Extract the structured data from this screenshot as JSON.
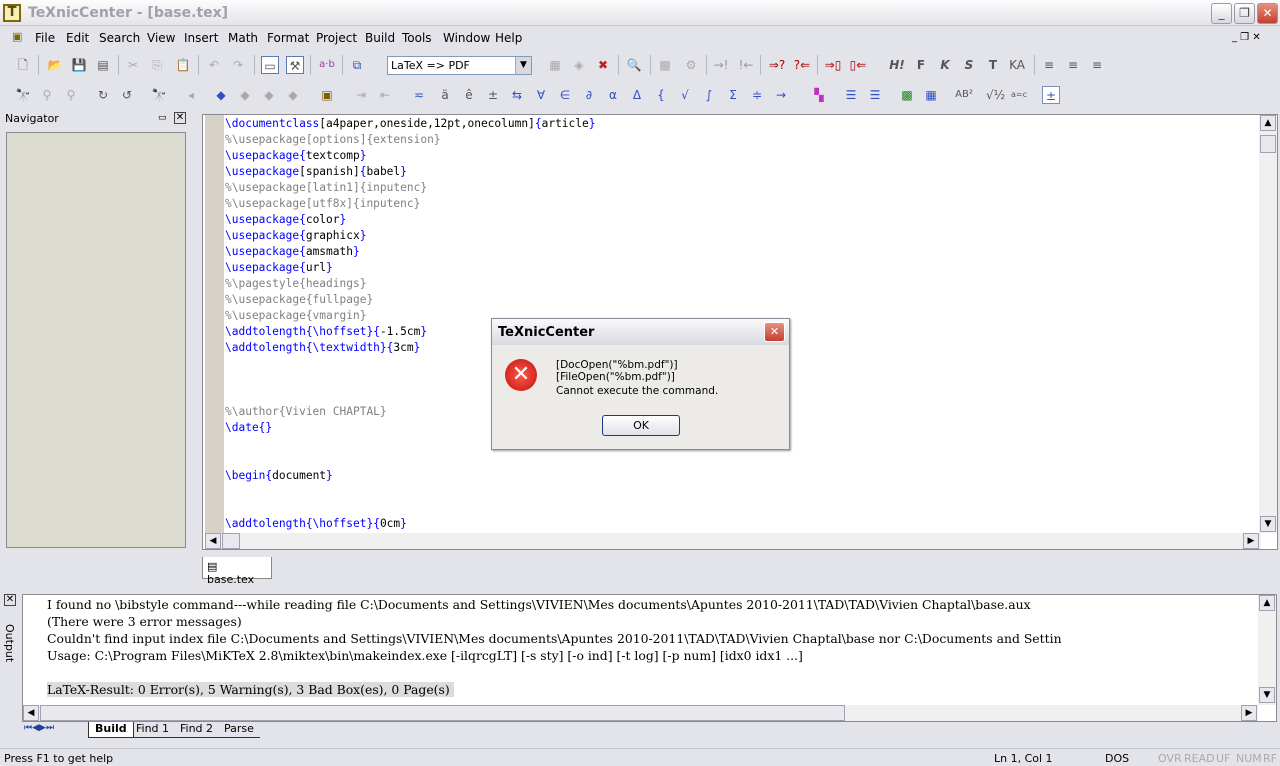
{
  "window": {
    "title": "TeXnicCenter - [base.tex]",
    "app_icon": "T"
  },
  "menu": [
    "File",
    "Edit",
    "Search",
    "View",
    "Insert",
    "Math",
    "Format",
    "Project",
    "Build",
    "Tools",
    "Window",
    "Help"
  ],
  "toolbar": {
    "build_profile": "LaTeX => PDF",
    "format_buttons": [
      "H!",
      "F",
      "K",
      "S",
      "T",
      "KA"
    ],
    "spell_label": "a·b"
  },
  "navigator": {
    "title": "Navigator"
  },
  "editor": {
    "lines": [
      [
        [
          "kw",
          "\\documentclass"
        ],
        [
          "",
          "[a4paper,oneside,12pt,onecolumn]"
        ],
        [
          "kw",
          "{"
        ],
        [
          "",
          "article"
        ],
        [
          "kw",
          "}"
        ]
      ],
      [
        [
          "cm",
          "%\\usepackage[options]{extension}"
        ]
      ],
      [
        [
          "kw",
          "\\usepackage{"
        ],
        [
          "",
          "textcomp"
        ],
        [
          "kw",
          "}"
        ]
      ],
      [
        [
          "kw",
          "\\usepackage"
        ],
        [
          "",
          "[spanish]"
        ],
        [
          "kw",
          "{"
        ],
        [
          "",
          "babel"
        ],
        [
          "kw",
          "}"
        ]
      ],
      [
        [
          "cm",
          "%\\usepackage[latin1]{inputenc}"
        ]
      ],
      [
        [
          "cm",
          "%\\usepackage[utf8x]{inputenc}"
        ]
      ],
      [
        [
          "kw",
          "\\usepackage{"
        ],
        [
          "",
          "color"
        ],
        [
          "kw",
          "}"
        ]
      ],
      [
        [
          "kw",
          "\\usepackage{"
        ],
        [
          "",
          "graphicx"
        ],
        [
          "kw",
          "}"
        ]
      ],
      [
        [
          "kw",
          "\\usepackage{"
        ],
        [
          "",
          "amsmath"
        ],
        [
          "kw",
          "}"
        ]
      ],
      [
        [
          "kw",
          "\\usepackage{"
        ],
        [
          "",
          "url"
        ],
        [
          "kw",
          "}"
        ]
      ],
      [
        [
          "cm",
          "%\\pagestyle{headings}"
        ]
      ],
      [
        [
          "cm",
          "%\\usepackage{fullpage}"
        ]
      ],
      [
        [
          "cm",
          "%\\usepackage{vmargin}"
        ]
      ],
      [
        [
          "kw",
          "\\addtolength{\\hoffset}"
        ],
        [
          "kw",
          "{"
        ],
        [
          "",
          "-1.5cm"
        ],
        [
          "kw",
          "}"
        ]
      ],
      [
        [
          "kw",
          "\\addtolength{\\textwidth}"
        ],
        [
          "kw",
          "{"
        ],
        [
          "",
          "3cm"
        ],
        [
          "kw",
          "}"
        ]
      ],
      [],
      [],
      [],
      [
        [
          "cm",
          "%\\author{Vivien CHAPTAL}"
        ]
      ],
      [
        [
          "kw",
          "\\date{}"
        ]
      ],
      [],
      [],
      [
        [
          "kw",
          "\\begin{"
        ],
        [
          "",
          "document"
        ],
        [
          "kw",
          "}"
        ]
      ],
      [],
      [],
      [
        [
          "kw",
          "\\addtolength{\\hoffset}"
        ],
        [
          "kw",
          "{"
        ],
        [
          "",
          "0cm"
        ],
        [
          "kw",
          "}"
        ]
      ]
    ],
    "tab": "base.tex"
  },
  "output": {
    "label": "Output",
    "lines": [
      "I found no \\bibstyle command---while reading file C:\\Documents and Settings\\VIVIEN\\Mes documents\\Apuntes 2010-2011\\TAD\\TAD\\Vivien Chaptal\\base.aux",
      "(There were 3 error messages)",
      "Couldn't find input index file C:\\Documents and Settings\\VIVIEN\\Mes documents\\Apuntes 2010-2011\\TAD\\TAD\\Vivien Chaptal\\base nor C:\\Documents and Settin",
      "Usage: C:\\Program Files\\MiKTeX 2.8\\miktex\\bin\\makeindex.exe [-ilqrcgLT] [-s sty] [-o ind] [-t log] [-p num] [idx0 idx1 ...]",
      ""
    ],
    "result": "LaTeX-Result: 0 Error(s), 5 Warning(s), 3 Bad Box(es), 0 Page(s)",
    "tabs": [
      "Build",
      "Find 1",
      "Find 2",
      "Parse"
    ]
  },
  "status": {
    "help": "Press F1 to get help",
    "position": "Ln 1, Col 1",
    "format": "DOS",
    "indicators": [
      "OVR",
      "READ",
      "UF",
      "NUM",
      "RF"
    ]
  },
  "dialog": {
    "title": "TeXnicCenter",
    "message1": "[DocOpen(\"%bm.pdf\")][FileOpen(\"%bm.pdf\")]",
    "message2": "Cannot execute the command.",
    "ok": "OK"
  }
}
